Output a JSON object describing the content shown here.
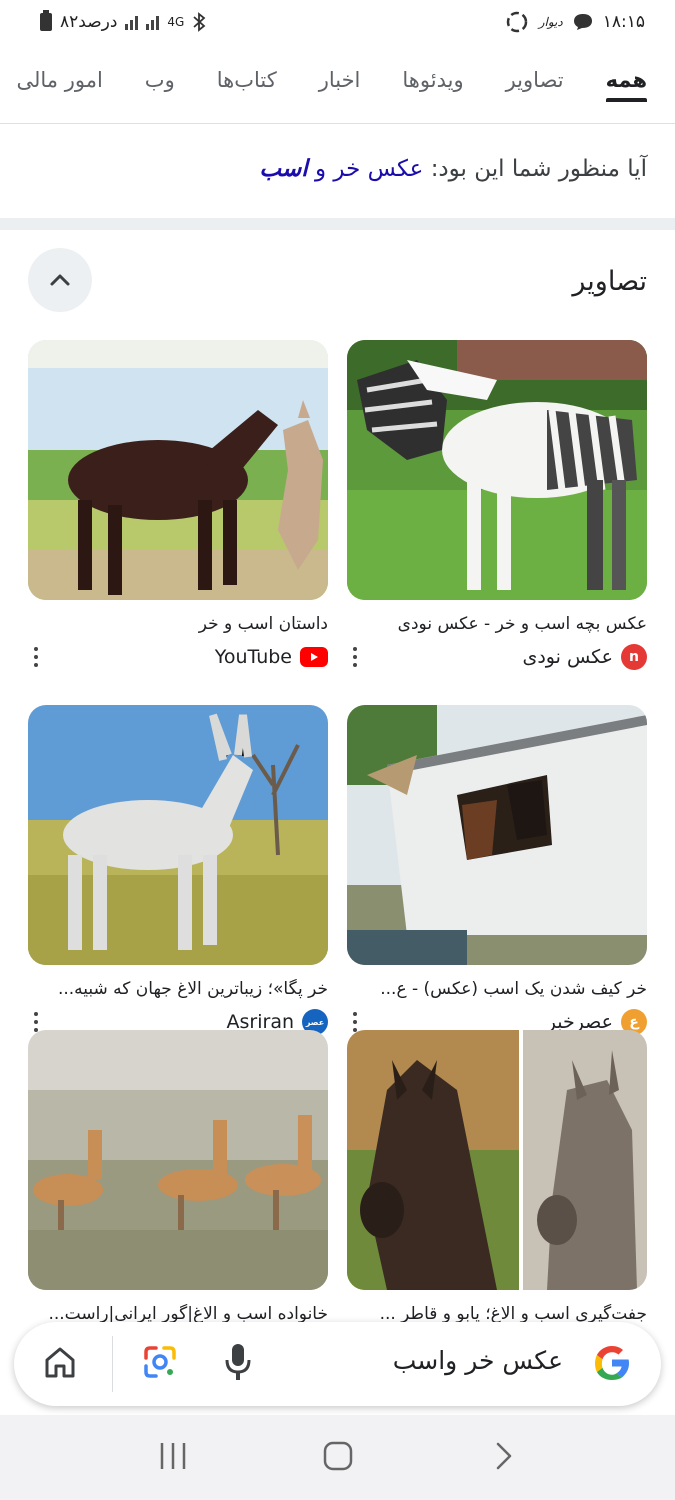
{
  "status_bar": {
    "time": "۱۸:۱۵",
    "battery_text": "۸۲درصد",
    "network": "4G",
    "app_label": "دیوار"
  },
  "tabs": [
    {
      "label": "همه",
      "active": true
    },
    {
      "label": "تصاویر",
      "active": false
    },
    {
      "label": "ویدئوها",
      "active": false
    },
    {
      "label": "اخبار",
      "active": false
    },
    {
      "label": "کتاب‌ها",
      "active": false
    },
    {
      "label": "وب",
      "active": false
    },
    {
      "label": "امور مالی",
      "active": false
    }
  ],
  "suggestion": {
    "prefix": "آیا منظور شما این بود:",
    "plain": "عکس خر و",
    "emphasis": "اسب"
  },
  "images_section": {
    "title": "تصاویر",
    "results": [
      {
        "caption": "عکس بچه اسب و خر - عکس نودی",
        "source": "عکس نودی",
        "favicon": "n",
        "favicon_color": "#e53935"
      },
      {
        "caption": "داستان اسب و خر",
        "source": "YouTube",
        "favicon": "▶",
        "favicon_color": "#ff0000"
      },
      {
        "caption": "خر کیف شدن یک اسب (عکس) - ع...",
        "source": "عصرخبر",
        "favicon": "ع",
        "favicon_color": "#f0a030"
      },
      {
        "caption": "خر پگا»؛ زیباترین الاغ جهان که شبیه...",
        "source": "Asriran",
        "favicon": "عصر",
        "favicon_color": "#1565c0"
      },
      {
        "caption": "جفت‌گیری اسب و الاغ؛ یابو و قاطر ...",
        "source": "",
        "favicon": "",
        "favicon_color": "#f9c02a"
      },
      {
        "caption": "خانواده اسب و الاغ|گور ایرانی|راست...",
        "source": "",
        "favicon": "",
        "favicon_color": "#2e7d32"
      }
    ]
  },
  "search_bar": {
    "query": "عکس خر واسب"
  },
  "colors": {
    "link": "#1a0dab",
    "divider": "#eceff1",
    "nav_bg": "#f2f2f4"
  }
}
